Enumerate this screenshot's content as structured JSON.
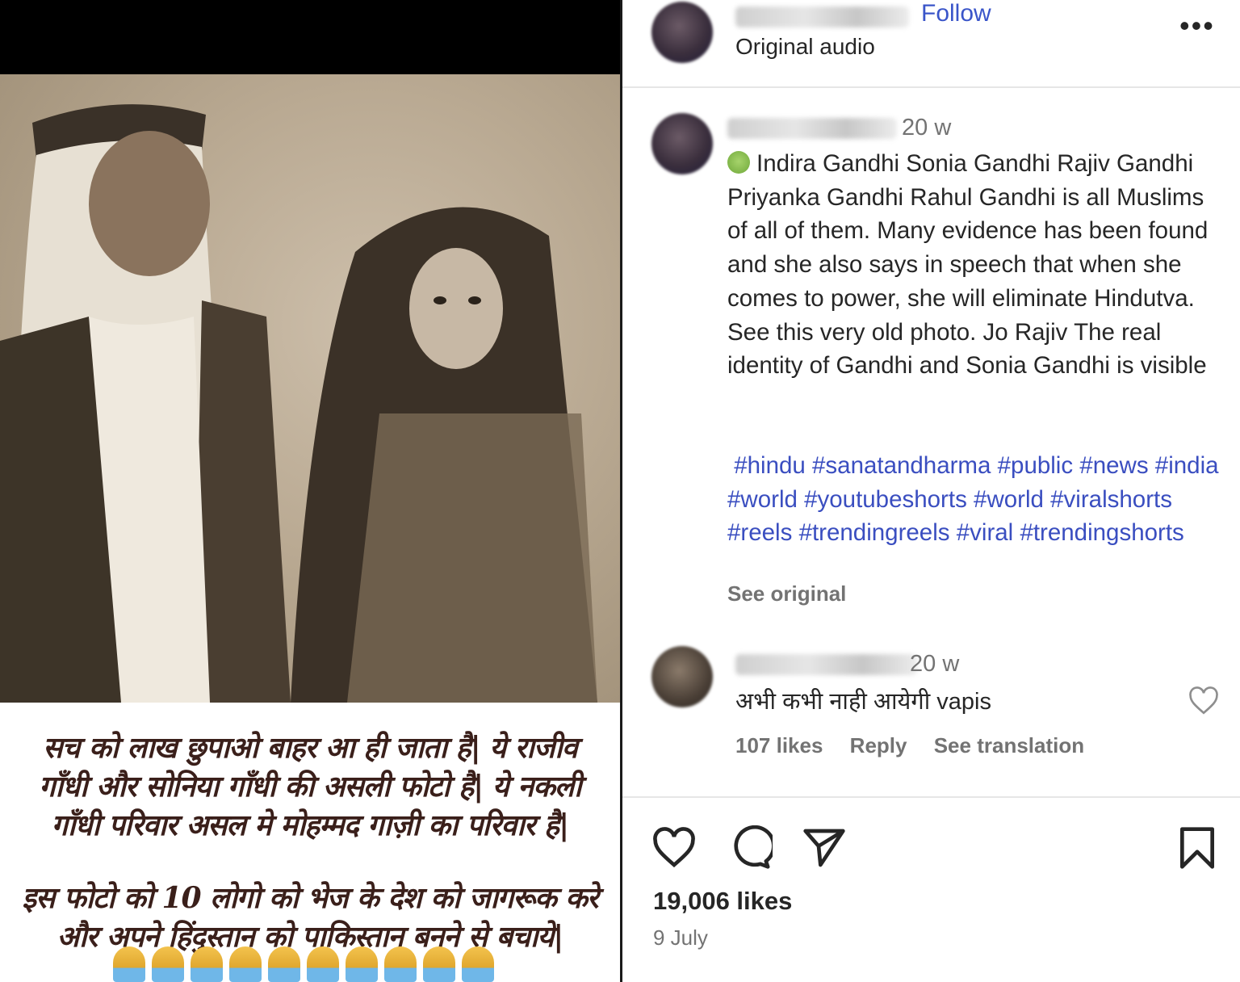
{
  "media": {
    "hindi_lines": [
      "सच को लाख छुपाओ बाहर आ ही जाता है| ये राजीव",
      "गाँधी और सोनिया गाँधी की असली फोटो है| ये नकली",
      "गाँधी परिवार असल मे मोहम्मद गाज़ी का परिवार है|",
      "इस फोटो को 10 लोगो को भेज के देश को जागरूक करे",
      "और अपने हिंदुस्तान को पाकिस्तान बनने से बचाये|"
    ]
  },
  "header": {
    "follow_label": "Follow",
    "audio_label": "Original audio",
    "more_icon": "more-horizontal-icon"
  },
  "caption_comment": {
    "time": "20 w",
    "text": "Indira Gandhi Sonia Gandhi Rajiv Gandhi Priyanka Gandhi Rahul Gandhi is all Muslims of all of them. Many evidence has been found and she also says in speech that when she comes to power, she will eliminate Hindutva. See this very old photo. Jo Rajiv The real identity of Gandhi and Sonia Gandhi is visible",
    "hashtags": [
      "#hindu",
      "#sanatandharma",
      "#public",
      "#news",
      "#india",
      "#world",
      "#youtubeshorts",
      "#world",
      "#viralshorts",
      "#reels",
      "#trendingreels",
      "#viral",
      "#trendingshorts"
    ],
    "see_original": "See original"
  },
  "reply_comment": {
    "time": "20 w",
    "text": "अभी कभी नाही आयेगी vapis",
    "likes": "107 likes",
    "reply_label": "Reply",
    "translation_label": "See translation"
  },
  "footer": {
    "likes": "19,006 likes",
    "date": "9 July"
  },
  "colors": {
    "link_blue": "#3a55c9",
    "hashtag_blue": "#3a4ec0",
    "muted_gray": "#737373",
    "text_dark": "#262626"
  }
}
